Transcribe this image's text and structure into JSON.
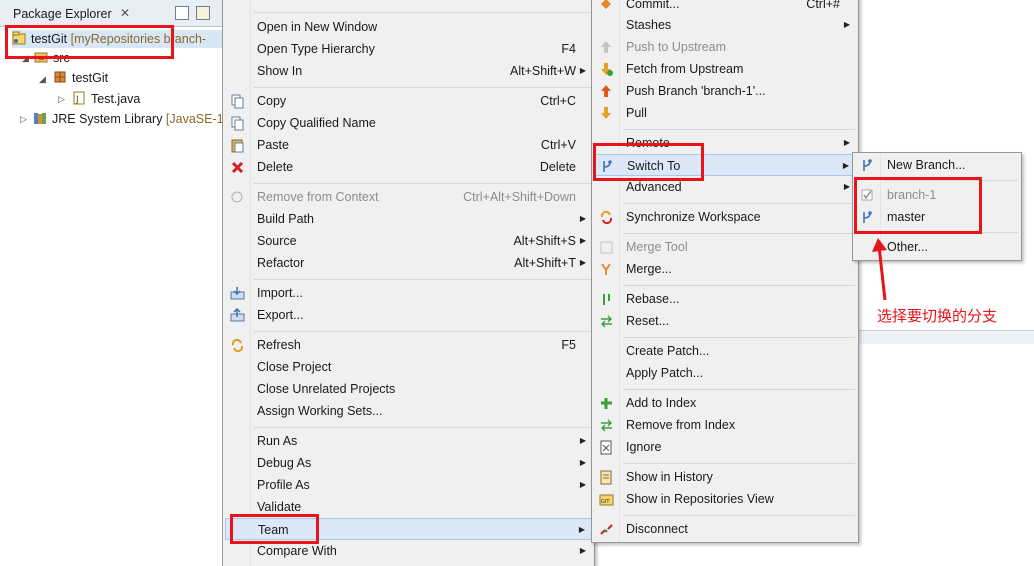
{
  "explorer": {
    "tab_title": "Package Explorer",
    "tab_close": "✕",
    "rows": [
      {
        "label": "testGit",
        "decoration": " [myRepositories branch-"
      },
      {
        "label": "src"
      },
      {
        "label": "testGit"
      },
      {
        "label": "Test.java"
      },
      {
        "label": "JRE System Library",
        "decoration": " [JavaSE-1"
      }
    ]
  },
  "context_menu": {
    "items": [
      {
        "label": "Open in New Window"
      },
      {
        "label": "Open Type Hierarchy",
        "shortcut": "F4"
      },
      {
        "label": "Show In",
        "shortcut": "Alt+Shift+W",
        "submenu": true
      },
      {
        "label": "Copy",
        "shortcut": "Ctrl+C",
        "icon": "copy-icon"
      },
      {
        "label": "Copy Qualified Name",
        "icon": "copy-qualified-icon"
      },
      {
        "label": "Paste",
        "shortcut": "Ctrl+V",
        "icon": "paste-icon"
      },
      {
        "label": "Delete",
        "shortcut": "Delete",
        "icon": "delete-icon"
      },
      {
        "label": "Remove from Context",
        "shortcut": "Ctrl+Alt+Shift+Down",
        "disabled": true,
        "icon": "remove-context-icon"
      },
      {
        "label": "Build Path",
        "submenu": true
      },
      {
        "label": "Source",
        "shortcut": "Alt+Shift+S",
        "submenu": true
      },
      {
        "label": "Refactor",
        "shortcut": "Alt+Shift+T",
        "submenu": true
      },
      {
        "label": "Import...",
        "icon": "import-icon"
      },
      {
        "label": "Export...",
        "icon": "export-icon"
      },
      {
        "label": "Refresh",
        "shortcut": "F5",
        "icon": "refresh-icon"
      },
      {
        "label": "Close Project"
      },
      {
        "label": "Close Unrelated Projects"
      },
      {
        "label": "Assign Working Sets..."
      },
      {
        "label": "Run As",
        "submenu": true
      },
      {
        "label": "Debug As",
        "submenu": true
      },
      {
        "label": "Profile As",
        "submenu": true
      },
      {
        "label": "Validate"
      },
      {
        "label": "Team",
        "submenu": true
      },
      {
        "label": "Compare With",
        "submenu": true
      }
    ]
  },
  "team_menu": {
    "items": [
      {
        "label": "Commit...",
        "shortcut": "Ctrl+#",
        "icon": "commit-icon"
      },
      {
        "label": "Stashes",
        "submenu": true
      },
      {
        "label": "Push to Upstream",
        "disabled": true,
        "icon": "push-upstream-icon"
      },
      {
        "label": "Fetch from Upstream",
        "icon": "fetch-upstream-icon"
      },
      {
        "label": "Push Branch 'branch-1'...",
        "icon": "push-branch-icon"
      },
      {
        "label": "Pull",
        "icon": "pull-icon"
      },
      {
        "label": "Remote",
        "submenu": true
      },
      {
        "label": "Switch To",
        "submenu": true,
        "icon": "switch-branch-icon"
      },
      {
        "label": "Advanced",
        "submenu": true
      },
      {
        "label": "Synchronize Workspace",
        "icon": "synchronize-icon"
      },
      {
        "label": "Merge Tool",
        "disabled": true,
        "icon": "merge-tool-icon"
      },
      {
        "label": "Merge...",
        "icon": "merge-icon"
      },
      {
        "label": "Rebase...",
        "icon": "rebase-icon"
      },
      {
        "label": "Reset...",
        "icon": "reset-icon"
      },
      {
        "label": "Create Patch..."
      },
      {
        "label": "Apply Patch..."
      },
      {
        "label": "Add to Index",
        "icon": "add-index-icon"
      },
      {
        "label": "Remove from Index",
        "icon": "remove-index-icon"
      },
      {
        "label": "Ignore",
        "icon": "ignore-icon"
      },
      {
        "label": "Show in History",
        "icon": "history-icon"
      },
      {
        "label": "Show in Repositories View",
        "icon": "repositories-icon"
      },
      {
        "label": "Disconnect",
        "icon": "disconnect-icon"
      }
    ]
  },
  "switch_menu": {
    "items": [
      {
        "label": "New Branch...",
        "icon": "new-branch-icon"
      },
      {
        "label": "branch-1",
        "disabled": true,
        "checked": true,
        "icon": "checked-branch-icon"
      },
      {
        "label": "master",
        "icon": "branch-icon"
      },
      {
        "label": "Other..."
      }
    ]
  },
  "annotation": {
    "text": "选择要切换的分支",
    "color": "#e8141b"
  },
  "colors": {
    "highlight": "#dce8f7",
    "menu_bg": "#f0f0f0",
    "annotation_red": "#e8141b"
  }
}
